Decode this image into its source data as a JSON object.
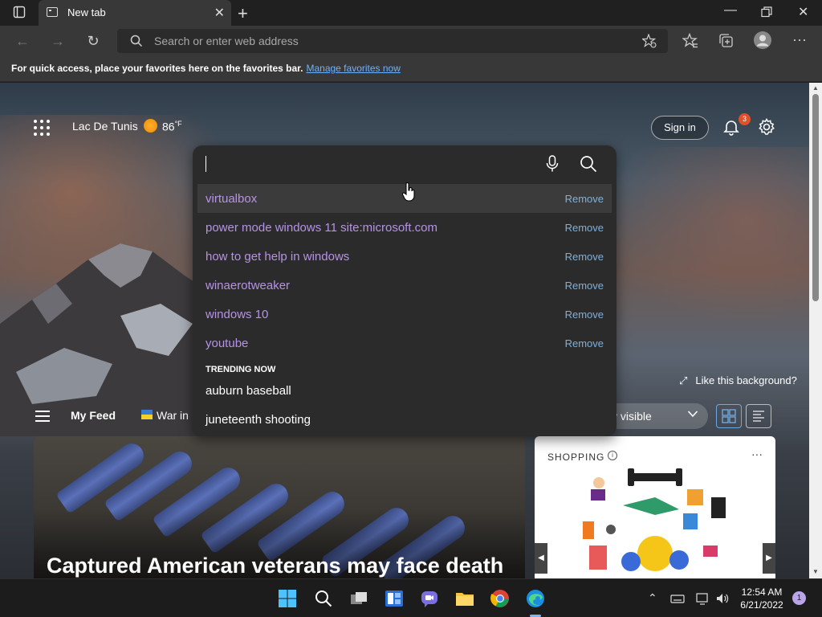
{
  "browser": {
    "tab_title": "New tab",
    "address_placeholder": "Search or enter web address",
    "favorites_bar_message": "For quick access, place your favorites here on the favorites bar.",
    "favorites_bar_link": "Manage favorites now"
  },
  "header": {
    "location": "Lac De Tunis",
    "temperature": "86",
    "temperature_unit": "°F",
    "sign_in_label": "Sign in",
    "notification_count": "3"
  },
  "search": {
    "suggestions": [
      {
        "text": "virtualbox",
        "action": "Remove"
      },
      {
        "text": "power mode windows 11 site:microsoft.com",
        "action": "Remove"
      },
      {
        "text": "how to get help in windows",
        "action": "Remove"
      },
      {
        "text": "winaerotweaker",
        "action": "Remove"
      },
      {
        "text": "windows 10",
        "action": "Remove"
      },
      {
        "text": "youtube",
        "action": "Remove"
      }
    ],
    "trending_heading": "TRENDING NOW",
    "trending": [
      "auburn baseball",
      "juneteenth shooting"
    ]
  },
  "background": {
    "like_label": "Like this background?"
  },
  "feed": {
    "my_feed_label": "My Feed",
    "war_label": "War in",
    "visibility_label": "y visible"
  },
  "cards": {
    "news_headline": "Captured American veterans may face death",
    "shopping_label": "SHOPPING",
    "shopping_info": "i",
    "shopping_more": "···"
  },
  "taskbar": {
    "time": "12:54 AM",
    "date": "6/21/2022",
    "notification_count": "1"
  },
  "colors": {
    "accent": "#6fb1ff",
    "suggestion_text": "#b693e6",
    "remove_text": "#7fb0d8",
    "badge": "#e0502a"
  }
}
